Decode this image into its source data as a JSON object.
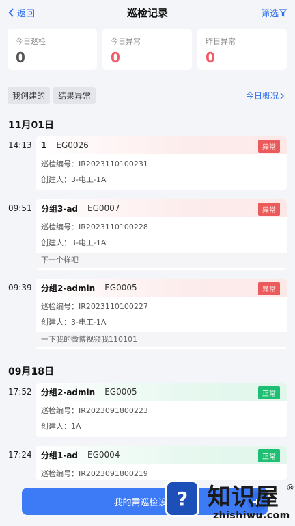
{
  "header": {
    "back_label": "返回",
    "title": "巡检记录",
    "filter_label": "筛选"
  },
  "stats": [
    {
      "label": "今日巡检",
      "value": "0"
    },
    {
      "label": "今日异常",
      "value": "0"
    },
    {
      "label": "昨日异常",
      "value": "0"
    }
  ],
  "chips": [
    "我创建的",
    "结果异常"
  ],
  "overview_label": "今日概况",
  "dates": [
    "11月01日",
    "09月18日"
  ],
  "records": [
    {
      "time": "14:13",
      "group": "1",
      "code": "EG0026",
      "status": "异常",
      "inspect_label": "巡检编号：",
      "inspect_no": "IR2023110100231",
      "creator_label": "创建人：",
      "creator": "3-电工-1A",
      "note": ""
    },
    {
      "time": "09:51",
      "group": "分组3-ad",
      "code": "EG0007",
      "status": "异常",
      "inspect_label": "巡检编号：",
      "inspect_no": "IR2023110100228",
      "creator_label": "创建人：",
      "creator": "3-电工-1A",
      "note": "下一个样吧"
    },
    {
      "time": "09:39",
      "group": "分组2-admin",
      "code": "EG0005",
      "status": "异常",
      "inspect_label": "巡检编号：",
      "inspect_no": "IR2023110100227",
      "creator_label": "创建人：",
      "creator": "3-电工-1A",
      "note": "一下我的微博视频我110101"
    },
    {
      "time": "17:52",
      "group": "分组2-admin",
      "code": "EG0005",
      "status": "正常",
      "inspect_label": "巡检编号：",
      "inspect_no": "IR2023091800223",
      "creator_label": "创建人：",
      "creator": "1A",
      "note": ""
    },
    {
      "time": "17:24",
      "group": "分组1-ad",
      "code": "EG0004",
      "status": "正常",
      "inspect_label": "巡检编号：",
      "inspect_no": "IR2023091800219",
      "creator_label": "",
      "creator": "",
      "note": ""
    }
  ],
  "bottom_button": "我的需巡检设备",
  "watermark": {
    "brand": "知识屋",
    "reg": "®",
    "url": "zhishiwu.com",
    "icon": "question-monitor-icon"
  },
  "colors": {
    "accent": "#2f6fef",
    "abnormal": "#ec5b5b",
    "normal": "#1fbf73"
  }
}
